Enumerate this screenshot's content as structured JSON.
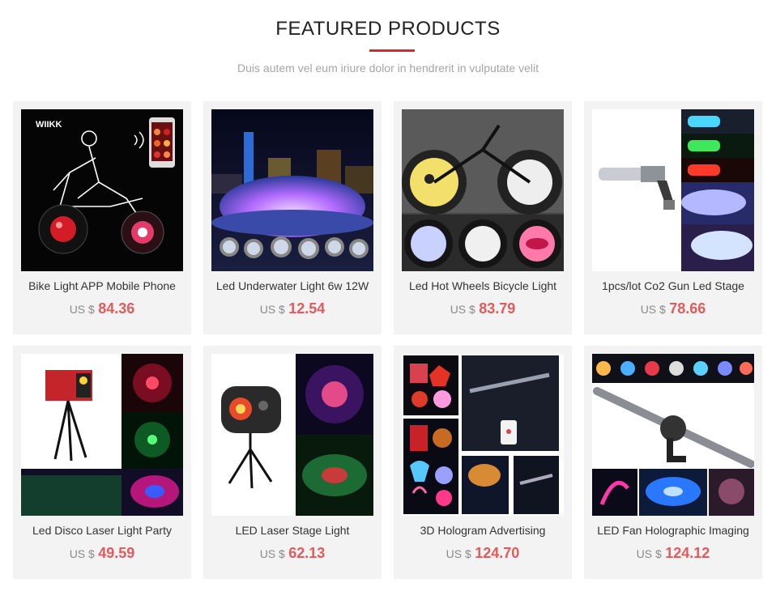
{
  "header": {
    "title": "FEATURED PRODUCTS",
    "subtitle": "Duis autem vel eum iriure dolor in hendrerit in vulputate velit",
    "accent_color": "#e0262d"
  },
  "products": [
    {
      "name": "Bike Light APP Mobile Phone",
      "currency": "US $",
      "price": "84.36",
      "image_text": "WIIKK"
    },
    {
      "name": "Led Underwater Light 6w 12W",
      "currency": "US $",
      "price": "12.54"
    },
    {
      "name": "Led Hot Wheels Bicycle Light",
      "currency": "US $",
      "price": "83.79"
    },
    {
      "name": "1pcs/lot Co2 Gun Led Stage",
      "currency": "US $",
      "price": "78.66"
    },
    {
      "name": "Led Disco Laser Light Party",
      "currency": "US $",
      "price": "49.59"
    },
    {
      "name": "LED Laser Stage Light",
      "currency": "US $",
      "price": "62.13"
    },
    {
      "name": "3D Hologram Advertising",
      "currency": "US $",
      "price": "124.70"
    },
    {
      "name": "LED Fan Holographic Imaging",
      "currency": "US $",
      "price": "124.12"
    }
  ],
  "colors": {
    "price": "#e25b5b",
    "card_bg": "#f3f3f3"
  }
}
